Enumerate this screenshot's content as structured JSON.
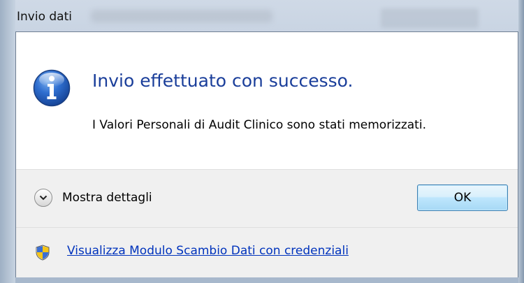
{
  "window": {
    "title": "Invio dati"
  },
  "dialog": {
    "main_instruction": "Invio effettuato con successo.",
    "content": "I Valori Personali di Audit Clinico sono stati memorizzati.",
    "icon": "information-icon"
  },
  "buttons": {
    "expander_label": "Mostra dettagli",
    "expander_icon": "chevron-down-icon",
    "ok_label": "OK"
  },
  "footer": {
    "icon": "uac-shield-icon",
    "link_text": "Visualizza Modulo Scambio Dati con credenziali"
  },
  "colors": {
    "instruction": "#1a3e9a",
    "link": "#0033bc",
    "ok_border": "#3c7fb1"
  }
}
